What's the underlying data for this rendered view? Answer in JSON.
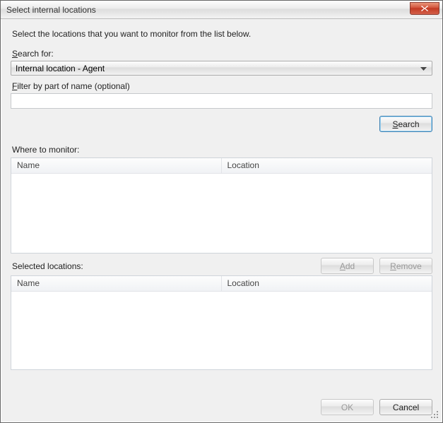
{
  "window": {
    "title": "Select internal locations"
  },
  "instruction": "Select the locations that you want to monitor from the list below.",
  "search": {
    "label_prefix": "S",
    "label_rest": "earch for:",
    "dropdown_value": "Internal location - Agent",
    "filter_label_prefix": "F",
    "filter_label_rest": "ilter by part of name (optional)",
    "filter_value": "",
    "button_prefix": "S",
    "button_rest": "earch"
  },
  "monitor": {
    "label": "Where to monitor:",
    "col_name": "Name",
    "col_location": "Location"
  },
  "actions": {
    "add_prefix": "A",
    "add_rest": "dd",
    "remove_prefix": "R",
    "remove_rest": "emove"
  },
  "selected": {
    "label": "Selected locations:",
    "col_name": "Name",
    "col_location": "Location"
  },
  "footer": {
    "ok": "OK",
    "cancel": "Cancel"
  }
}
